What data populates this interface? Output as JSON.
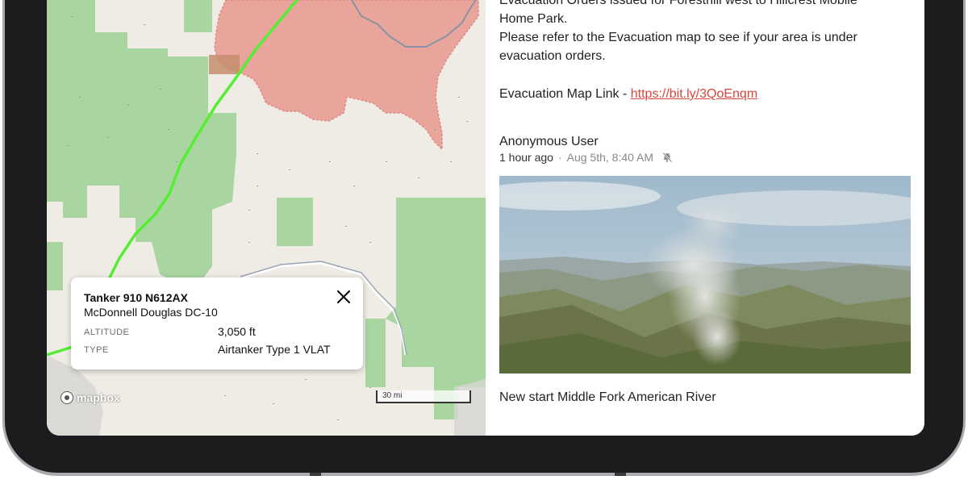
{
  "feed": {
    "post1": {
      "line1": "Evacuation Orders issued for Foresthill west to Hillcrest Mobile",
      "line2": "Home Park.",
      "line3": "Please refer to the Evacuation map to see if your area is under",
      "line4": "evacuation orders.",
      "link_prefix": "Evacuation Map Link - ",
      "link_text": "https://bit.ly/3QoEnqm"
    },
    "post2": {
      "author": "Anonymous User",
      "relative_time": "1 hour ago",
      "separator": "·",
      "date": "Aug 5th,  8:40 AM",
      "notify_icon": "bell-off-icon",
      "caption": "New start Middle Fork American River"
    }
  },
  "map": {
    "popup": {
      "title": "Tanker 910 N612AX",
      "subtitle": "McDonnell Douglas DC-10",
      "altitude_label": "ALTITUDE",
      "altitude_value": "3,050 ft",
      "type_label": "TYPE",
      "type_value": "Airtanker Type 1 VLAT",
      "close_icon": "close-icon"
    },
    "attribution": "mapbox",
    "scale_label": "30 mi",
    "colors": {
      "land": "#efece5",
      "forest": "#a9d5a0",
      "fire_perimeter": "#e9a49c",
      "flight_track": "#55ee33"
    }
  }
}
